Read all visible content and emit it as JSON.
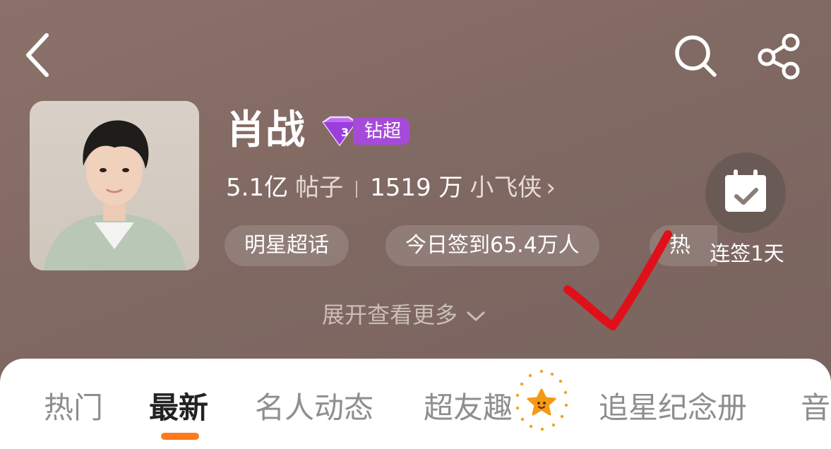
{
  "header": {
    "back_icon": "chevron-left-icon",
    "search_icon": "search-icon",
    "share_icon": "share-icon"
  },
  "profile": {
    "name": "肖战",
    "badge_label": "钻超",
    "badge_icon": "diamond-icon",
    "posts_count": "5.1亿",
    "posts_label": "帖子",
    "followers_count": "1519 万",
    "followers_label": "小飞侠",
    "followers_chevron": "›"
  },
  "chips": [
    "明星超话",
    "今日签到65.4万人",
    "热"
  ],
  "checkin": {
    "label": "连签1天",
    "icon": "calendar-check-icon"
  },
  "expand": {
    "label": "展开查看更多",
    "icon": "chevron-down-icon"
  },
  "tabs": {
    "items": [
      "热门",
      "最新",
      "名人动态",
      "超友趣",
      "追星纪念册",
      "音"
    ],
    "active": "最新"
  },
  "colors": {
    "hero_bg": "#8b7169",
    "accent": "#ff7a1a",
    "badge": "#a64bd9",
    "annotation": "#e0101a"
  }
}
